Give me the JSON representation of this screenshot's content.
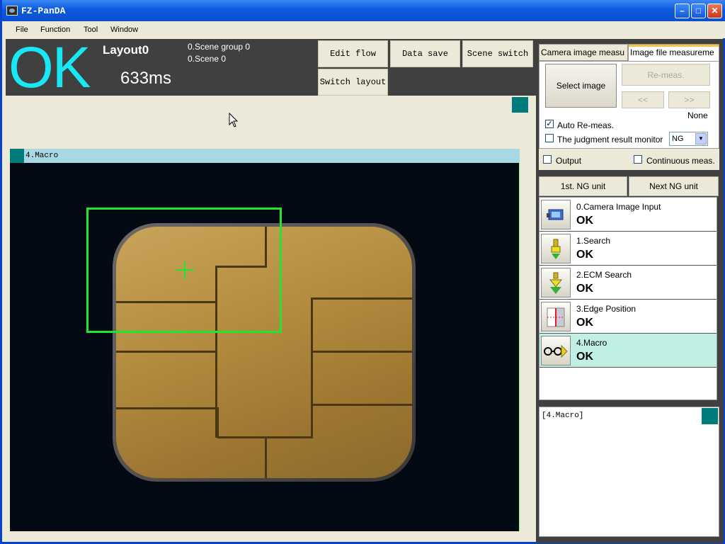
{
  "window": {
    "title": "FZ-PanDA"
  },
  "menu": [
    "File",
    "Function",
    "Tool",
    "Window"
  ],
  "status": {
    "result": "OK",
    "layout": "Layout0",
    "time": "633ms",
    "scene_group": "0.Scene group 0",
    "scene": "0.Scene 0",
    "result_color": "#19e8f4"
  },
  "toolbar": {
    "edit_flow": "Edit flow",
    "data_save": "Data save",
    "scene_switch": "Scene switch",
    "switch_layout": "Switch layout"
  },
  "image_window": {
    "title": "4.Macro"
  },
  "tabs": [
    {
      "label": "Camera image measu"
    },
    {
      "label": "Image file measureme"
    }
  ],
  "file_panel": {
    "select_image": "Select image",
    "remeas": "Re-meas.",
    "prev": "<<",
    "next": ">>",
    "file_name": "None",
    "auto_remeas_label": "Auto Re-meas.",
    "auto_remeas_checked": true,
    "judgment_monitor_label": "The judgment result monitor",
    "judgment_monitor_checked": false,
    "judgment_value": "NG"
  },
  "output_options": {
    "output_label": "Output",
    "continuous_label": "Continuous meas."
  },
  "ng_buttons": {
    "first": "1st. NG unit",
    "next": "Next NG unit"
  },
  "flow": [
    {
      "name": "0.Camera Image Input",
      "result": "OK",
      "icon": "camera-input-icon"
    },
    {
      "name": "1.Search",
      "result": "OK",
      "icon": "search-icon"
    },
    {
      "name": "2.ECM Search",
      "result": "OK",
      "icon": "ecm-search-icon"
    },
    {
      "name": "3.Edge Position",
      "result": "OK",
      "icon": "edge-position-icon"
    },
    {
      "name": "4.Macro",
      "result": "OK",
      "icon": "macro-icon"
    }
  ],
  "log": {
    "text": "[4.Macro]"
  }
}
